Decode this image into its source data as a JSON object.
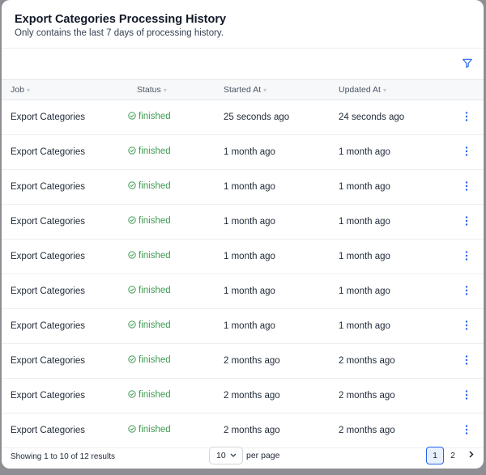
{
  "header": {
    "title": "Export Categories Processing History",
    "subtitle": "Only contains the last 7 days of processing history."
  },
  "toolbar": {
    "filter_icon": "filter-icon"
  },
  "columns": [
    "Job",
    "Status",
    "Started At",
    "Updated At"
  ],
  "rows": [
    {
      "job": "Export Categories",
      "status": "finished",
      "started": "25 seconds ago",
      "updated": "24 seconds ago"
    },
    {
      "job": "Export Categories",
      "status": "finished",
      "started": "1 month ago",
      "updated": "1 month ago"
    },
    {
      "job": "Export Categories",
      "status": "finished",
      "started": "1 month ago",
      "updated": "1 month ago"
    },
    {
      "job": "Export Categories",
      "status": "finished",
      "started": "1 month ago",
      "updated": "1 month ago"
    },
    {
      "job": "Export Categories",
      "status": "finished",
      "started": "1 month ago",
      "updated": "1 month ago"
    },
    {
      "job": "Export Categories",
      "status": "finished",
      "started": "1 month ago",
      "updated": "1 month ago"
    },
    {
      "job": "Export Categories",
      "status": "finished",
      "started": "1 month ago",
      "updated": "1 month ago"
    },
    {
      "job": "Export Categories",
      "status": "finished",
      "started": "2 months ago",
      "updated": "2 months ago"
    },
    {
      "job": "Export Categories",
      "status": "finished",
      "started": "2 months ago",
      "updated": "2 months ago"
    },
    {
      "job": "Export Categories",
      "status": "finished",
      "started": "2 months ago",
      "updated": "2 months ago"
    }
  ],
  "footer": {
    "summary": "Showing 1 to 10 of 12 results",
    "per_page_value": "10",
    "per_page_label": "per page",
    "pages": [
      "1",
      "2"
    ],
    "current_page": "1"
  },
  "colors": {
    "status_finished": "#3f9b52",
    "accent": "#2563eb"
  }
}
